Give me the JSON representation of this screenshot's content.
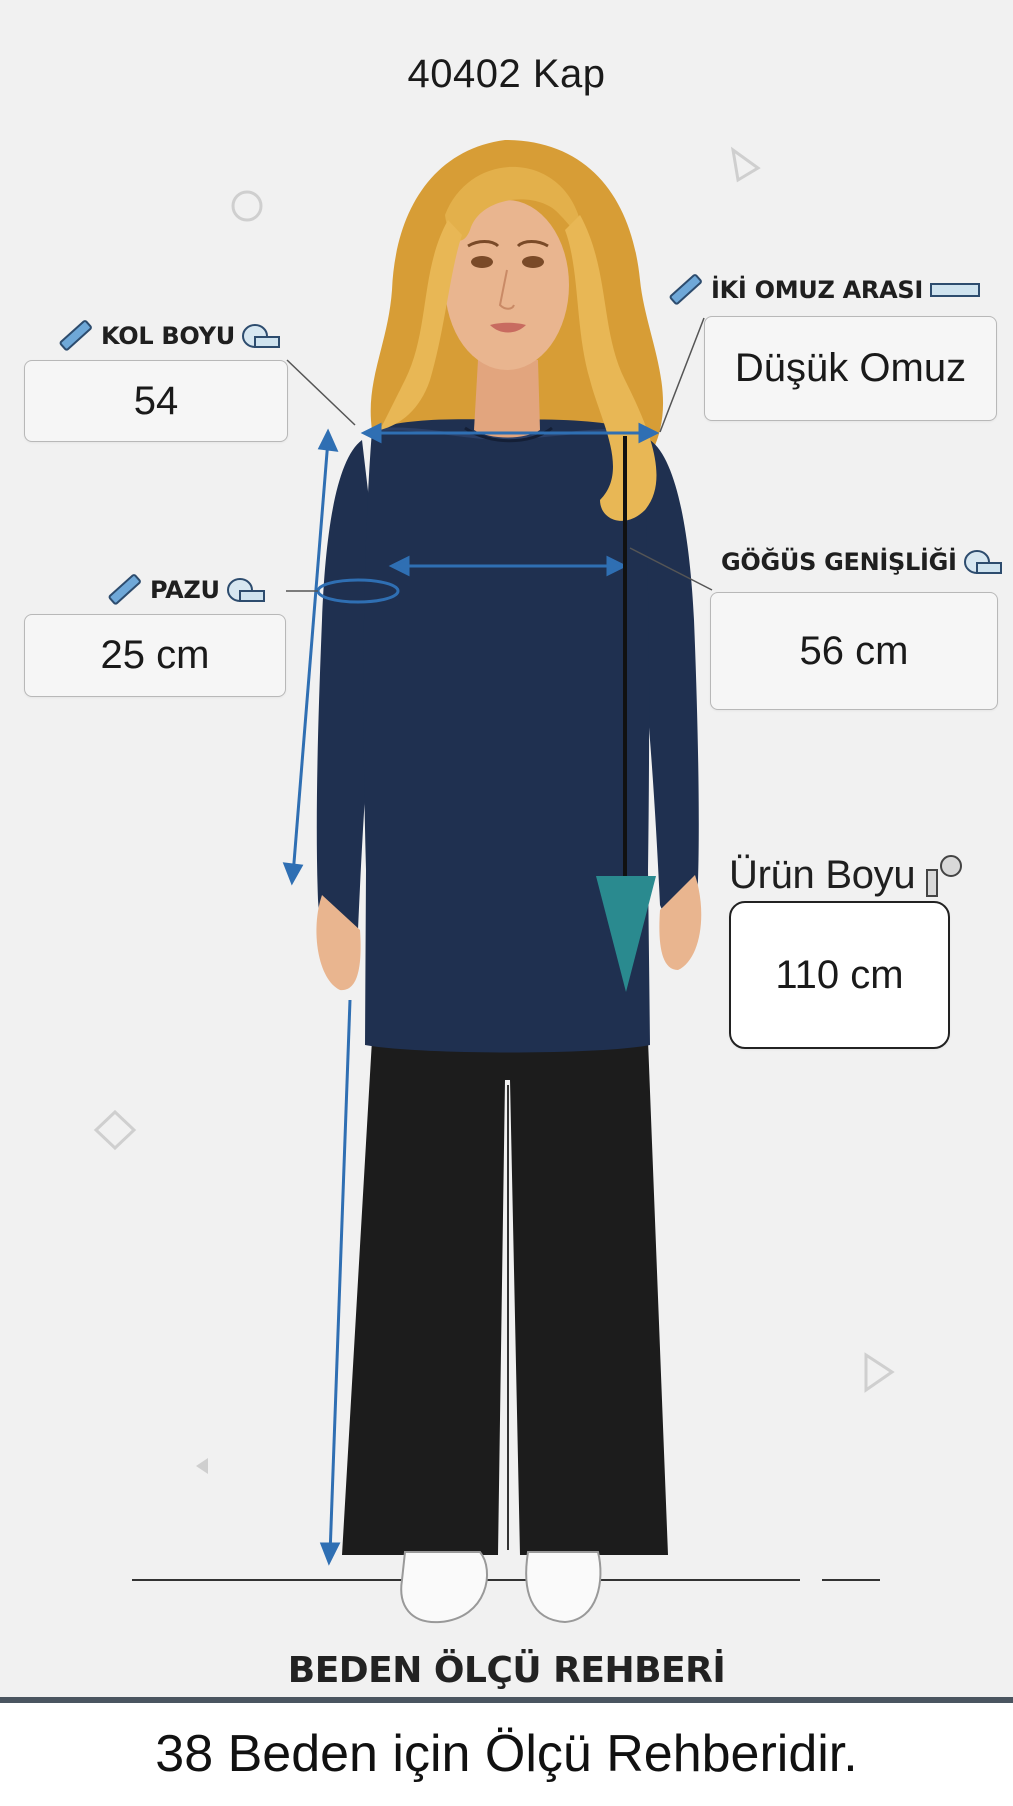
{
  "title": "40402 Kap",
  "labels": {
    "kol_boyu": "KOL BOYU",
    "iki_omuz": "İKİ OMUZ ARASI",
    "pazu": "PAZU",
    "gogus": "GÖĞÜS GENİŞLİĞİ",
    "urun_boyu": "Ürün Boyu"
  },
  "values": {
    "kol_boyu": "54",
    "iki_omuz": "Düşük Omuz",
    "pazu": "25 cm",
    "gogus": "56 cm",
    "urun_boyu": "110 cm"
  },
  "guide_title": "BEDEN ÖLÇÜ REHBERİ",
  "footer_note": "38 Beden için Ölçü Rehberidir.",
  "colors": {
    "background": "#f1f1f1",
    "tunic": "#1f3050",
    "pants": "#1c1c1c",
    "hair": "#e3b04b",
    "skin": "#e9b58f",
    "arrow": "#2f6fb3",
    "teal": "#2a8a8f"
  },
  "icons": [
    "ruler-icon",
    "tape-measure-icon"
  ]
}
